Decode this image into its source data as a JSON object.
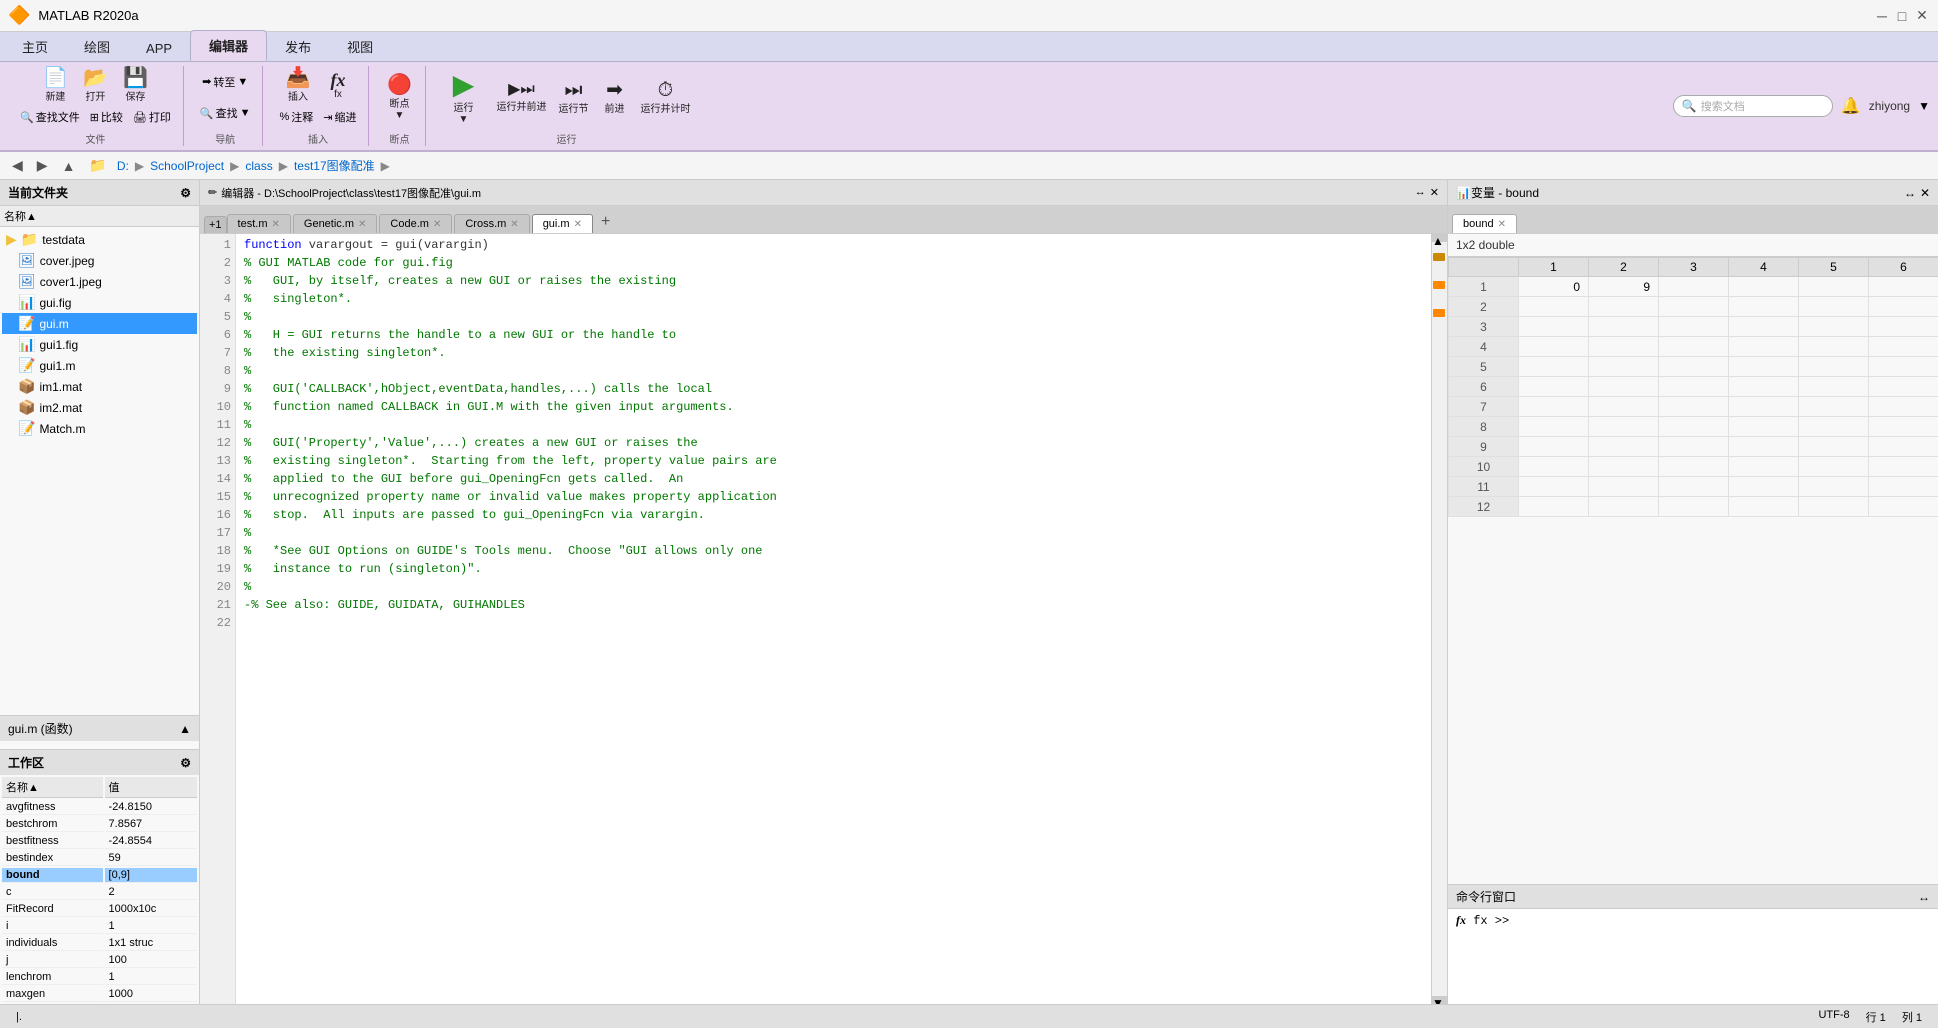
{
  "app": {
    "title": "MATLAB R2020a",
    "logo": "🔶"
  },
  "titlebar": {
    "title": "MATLAB R2020a",
    "minimize": "─",
    "maximize": "□",
    "close": "✕"
  },
  "ribbon": {
    "tabs": [
      {
        "label": "主页",
        "active": false
      },
      {
        "label": "绘图",
        "active": false
      },
      {
        "label": "APP",
        "active": false
      },
      {
        "label": "编辑器",
        "active": true
      },
      {
        "label": "发布",
        "active": false
      },
      {
        "label": "视图",
        "active": false
      }
    ],
    "groups": {
      "file": {
        "label": "文件",
        "buttons": [
          "新建",
          "打开",
          "保存",
          "查找文件",
          "比较",
          "打印"
        ]
      },
      "nav": {
        "label": "导航",
        "buttons": [
          "转至",
          "查找"
        ]
      },
      "insert": {
        "label": "插入",
        "buttons": [
          "注释",
          "缩进",
          "fx",
          "插入"
        ]
      },
      "breakpoints": {
        "label": "断点",
        "buttons": [
          "断点"
        ]
      },
      "run": {
        "label": "运行",
        "buttons": [
          "运行",
          "运行并前进",
          "运行节",
          "前进",
          "运行并计时"
        ]
      }
    }
  },
  "addressbar": {
    "path": "D: ▶ SchoolProject ▶ class ▶ test17图像配准 ▶",
    "segments": [
      "D:",
      "SchoolProject",
      "class",
      "test17图像配准"
    ]
  },
  "filebrowser": {
    "header": "当前文件夹",
    "column": "名称▲",
    "files": [
      {
        "name": "testdata",
        "type": "folder"
      },
      {
        "name": "cover.jpeg",
        "type": "image"
      },
      {
        "name": "cover1.jpeg",
        "type": "image"
      },
      {
        "name": "gui.fig",
        "type": "fig"
      },
      {
        "name": "gui.m",
        "type": "m",
        "selected": true
      },
      {
        "name": "gui1.fig",
        "type": "fig"
      },
      {
        "name": "gui1.m",
        "type": "m"
      },
      {
        "name": "im1.mat",
        "type": "mat"
      },
      {
        "name": "im2.mat",
        "type": "mat"
      },
      {
        "name": "Match.m",
        "type": "m"
      }
    ]
  },
  "function_section": {
    "header": "gui.m (函数)",
    "content": ""
  },
  "workspace": {
    "header": "工作区",
    "columns": [
      "名称▲",
      "值"
    ],
    "variables": [
      {
        "name": "avgfitness",
        "value": "-24.8150",
        "selected": false
      },
      {
        "name": "bestchrom",
        "value": "7.8567",
        "selected": false
      },
      {
        "name": "bestfitness",
        "value": "-24.8554",
        "selected": false
      },
      {
        "name": "bestindex",
        "value": "59",
        "selected": false
      },
      {
        "name": "bound",
        "value": "[0,9]",
        "selected": true
      },
      {
        "name": "c",
        "value": "2",
        "selected": false
      },
      {
        "name": "FitRecord",
        "value": "1000x10c",
        "selected": false
      },
      {
        "name": "i",
        "value": "1",
        "selected": false
      },
      {
        "name": "individuals",
        "value": "1x1 struc",
        "selected": false
      },
      {
        "name": "j",
        "value": "100",
        "selected": false
      },
      {
        "name": "lenchrom",
        "value": "1",
        "selected": false
      },
      {
        "name": "maxgen",
        "value": "1000",
        "selected": false
      }
    ]
  },
  "editor": {
    "header": "编辑器 - D:\\SchoolProject\\class\\test17图像配准\\gui.m",
    "tabs": [
      {
        "label": "test.m",
        "active": false,
        "closable": true
      },
      {
        "label": "Genetic.m",
        "active": false,
        "closable": true
      },
      {
        "label": "Code.m",
        "active": false,
        "closable": true
      },
      {
        "label": "Cross.m",
        "active": false,
        "closable": true
      },
      {
        "label": "gui.m",
        "active": true,
        "closable": true
      }
    ],
    "lines": [
      {
        "num": 1,
        "code": "function varargout = gui(varargin)",
        "type": "code"
      },
      {
        "num": 2,
        "code": "% GUI MATLAB code for gui.fig",
        "type": "comment"
      },
      {
        "num": 3,
        "code": "%   GUI, by itself, creates a new GUI or raises the existing",
        "type": "comment"
      },
      {
        "num": 4,
        "code": "%   singleton*.",
        "type": "comment"
      },
      {
        "num": 5,
        "code": "%",
        "type": "comment"
      },
      {
        "num": 6,
        "code": "%   H = GUI returns the handle to a new GUI or the handle to",
        "type": "comment"
      },
      {
        "num": 7,
        "code": "%   the existing singleton*.",
        "type": "comment"
      },
      {
        "num": 8,
        "code": "%",
        "type": "comment"
      },
      {
        "num": 9,
        "code": "%   GUI('CALLBACK',hObject,eventData,handles,...) calls the local",
        "type": "comment"
      },
      {
        "num": 10,
        "code": "%   function named CALLBACK in GUI.M with the given input arguments.",
        "type": "comment"
      },
      {
        "num": 11,
        "code": "%",
        "type": "comment"
      },
      {
        "num": 12,
        "code": "%   GUI('Property','Value',...) creates a new GUI or raises the",
        "type": "comment"
      },
      {
        "num": 13,
        "code": "%   existing singleton*.  Starting from the left, property value pairs are",
        "type": "comment"
      },
      {
        "num": 14,
        "code": "%   applied to the GUI before gui_OpeningFcn gets called.  An",
        "type": "comment"
      },
      {
        "num": 15,
        "code": "%   unrecognized property name or invalid value makes property application",
        "type": "comment"
      },
      {
        "num": 16,
        "code": "%   stop.  All inputs are passed to gui_OpeningFcn via varargin.",
        "type": "comment"
      },
      {
        "num": 17,
        "code": "%",
        "type": "comment"
      },
      {
        "num": 18,
        "code": "%   *See GUI Options on GUIDE's Tools menu.  Choose \"GUI allows only one",
        "type": "comment"
      },
      {
        "num": 19,
        "code": "%   instance to run (singleton)\".",
        "type": "comment"
      },
      {
        "num": 20,
        "code": "%",
        "type": "comment"
      },
      {
        "num": 21,
        "code": "-% See also: GUIDE, GUIDATA, GUIHANDLES",
        "type": "comment"
      },
      {
        "num": 22,
        "code": "",
        "type": "code"
      }
    ]
  },
  "variable_viewer": {
    "title": "变量 - bound",
    "variable_name": "bound",
    "type_info": "1x2 double",
    "columns": [
      "1",
      "2",
      "3",
      "4",
      "5",
      "6"
    ],
    "rows": [
      {
        "header": "1",
        "values": [
          "0",
          "9",
          "",
          "",
          "",
          ""
        ]
      },
      {
        "header": "2",
        "values": [
          "",
          "",
          "",
          "",
          "",
          ""
        ]
      },
      {
        "header": "3",
        "values": [
          "",
          "",
          "",
          "",
          "",
          ""
        ]
      },
      {
        "header": "4",
        "values": [
          "",
          "",
          "",
          "",
          "",
          ""
        ]
      },
      {
        "header": "5",
        "values": [
          "",
          "",
          "",
          "",
          "",
          ""
        ]
      },
      {
        "header": "6",
        "values": [
          "",
          "",
          "",
          "",
          "",
          ""
        ]
      },
      {
        "header": "7",
        "values": [
          "",
          "",
          "",
          "",
          "",
          ""
        ]
      },
      {
        "header": "8",
        "values": [
          "",
          "",
          "",
          "",
          "",
          ""
        ]
      },
      {
        "header": "9",
        "values": [
          "",
          "",
          "",
          "",
          "",
          ""
        ]
      },
      {
        "header": "10",
        "values": [
          "",
          "",
          "",
          "",
          "",
          ""
        ]
      },
      {
        "header": "11",
        "values": [
          "",
          "",
          "",
          "",
          "",
          ""
        ]
      },
      {
        "header": "12",
        "values": [
          "",
          "",
          "",
          "",
          "",
          ""
        ]
      }
    ]
  },
  "command_window": {
    "header": "命令行窗口",
    "prompt": "fx >>",
    "content": ""
  },
  "statusbar": {
    "encoding": "UTF-8",
    "row": "行 1",
    "col": "列 1"
  },
  "search": {
    "placeholder": "搜索文档"
  },
  "user": {
    "name": "zhiyong"
  }
}
